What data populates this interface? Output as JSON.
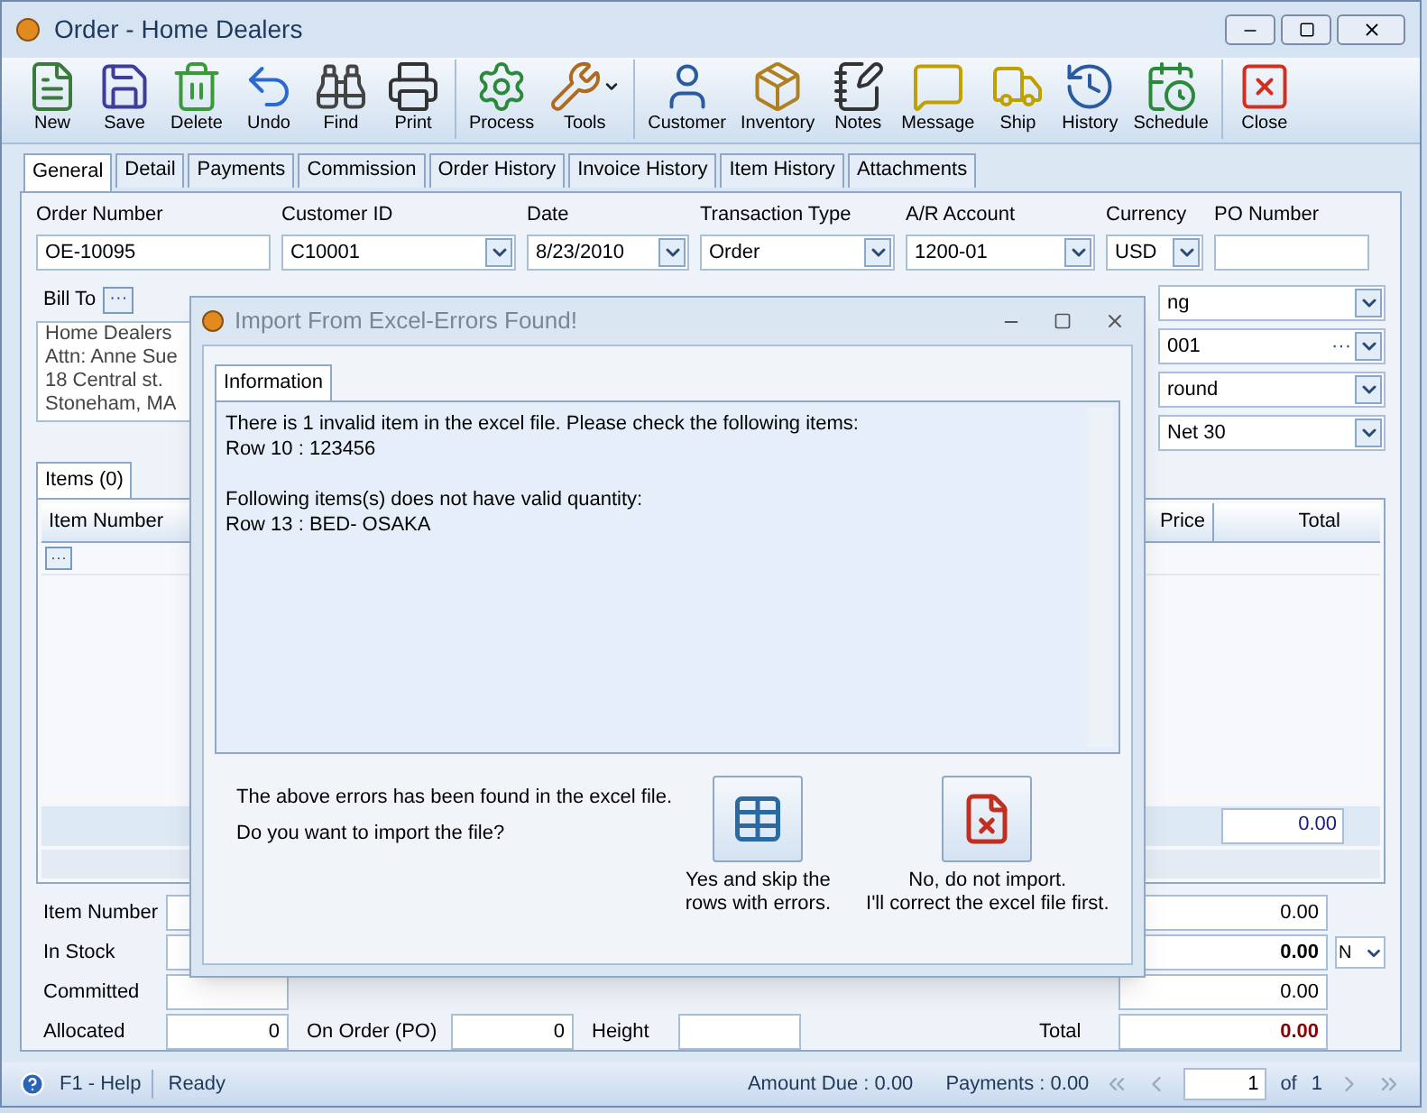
{
  "window": {
    "title": "Order - Home Dealers"
  },
  "toolbar": [
    {
      "label": "New"
    },
    {
      "label": "Save"
    },
    {
      "label": "Delete"
    },
    {
      "label": "Undo"
    },
    {
      "label": "Find"
    },
    {
      "label": "Print",
      "separator_after": true
    },
    {
      "label": "Process"
    },
    {
      "label": "Tools",
      "dropdown": true,
      "separator_after": true
    },
    {
      "label": "Customer"
    },
    {
      "label": "Inventory"
    },
    {
      "label": "Notes"
    },
    {
      "label": "Message"
    },
    {
      "label": "Ship"
    },
    {
      "label": "History"
    },
    {
      "label": "Schedule",
      "separator_after": true
    },
    {
      "label": "Close"
    }
  ],
  "tabs": [
    {
      "label": "General",
      "selected": true
    },
    {
      "label": "Detail",
      "selected": false
    },
    {
      "label": "Payments",
      "selected": false
    },
    {
      "label": "Commission",
      "selected": false
    },
    {
      "label": "Order History",
      "selected": false
    },
    {
      "label": "Invoice History",
      "selected": false
    },
    {
      "label": "Item History",
      "selected": false
    },
    {
      "label": "Attachments",
      "selected": false
    }
  ],
  "header_fields": [
    {
      "label": "Order Number",
      "value": "OE-10095",
      "kind": "text"
    },
    {
      "label": "Customer ID",
      "value": "C10001",
      "kind": "dropdown"
    },
    {
      "label": "Date",
      "value": "8/23/2010",
      "kind": "dropdown"
    },
    {
      "label": "Transaction Type",
      "value": "Order",
      "kind": "dropdown"
    },
    {
      "label": "A/R Account",
      "value": "1200-01",
      "kind": "dropdown"
    },
    {
      "label": "Currency",
      "value": "USD",
      "kind": "dropdown"
    },
    {
      "label": "PO Number",
      "kind": "text"
    }
  ],
  "bill_to": {
    "label": "Bill To",
    "button": "···",
    "lines": [
      "Home Dealers",
      "Attn: Anne Sue",
      "18 Central st.",
      "Stoneham, MA"
    ]
  },
  "right_fields": [
    {
      "value": "ng",
      "kind": "dropdown"
    },
    {
      "value": "001",
      "kind": "lookup",
      "button": "···"
    },
    {
      "value": "round",
      "kind": "dropdown"
    },
    {
      "value": "Net 30",
      "kind": "dropdown"
    }
  ],
  "items": {
    "tab": "Items (0)",
    "columns": [
      "Item Number",
      "Price",
      "Total"
    ],
    "row_button": "···",
    "footer_total": "0.00"
  },
  "bottom": {
    "left": [
      {
        "label": "Item Number"
      },
      {
        "label": "In Stock"
      },
      {
        "label": "Committed"
      },
      {
        "label": "Allocated",
        "value": "0"
      }
    ],
    "middle": {
      "label": "On Order (PO)",
      "value": "0"
    },
    "third": {
      "label": "Height"
    },
    "right": [
      {
        "value": "0.00",
        "kind": "plain"
      },
      {
        "value": "0.00",
        "kind": "bold",
        "dropdown": "N"
      },
      {
        "value": "0.00",
        "kind": "plain"
      },
      {
        "label": "Total",
        "value": "0.00",
        "kind": "total"
      }
    ]
  },
  "status_bar": {
    "help": "F1 - Help",
    "status": "Ready",
    "amount_due": "Amount Due : 0.00",
    "payments": "Payments : 0.00",
    "page": "1",
    "of": "of",
    "total_pages": "1"
  },
  "dialog": {
    "title": "Import From Excel-Errors Found!",
    "tab": {
      "label": "Information",
      "selected": true
    },
    "message_blocks": [
      [
        "There is 1 invalid item in the excel file. Please check the following items:",
        "Row 10 : 123456"
      ],
      [
        "Following items(s) does not have valid quantity:",
        "Row 13 : BED- OSAKA"
      ]
    ],
    "prompt": [
      "The above errors has been found in the excel file.",
      "Do you want to import the file?"
    ],
    "buttons": [
      {
        "kind": "skip",
        "label": "Yes and skip the\nrows with errors."
      },
      {
        "kind": "cancel",
        "label": "No, do not import.\nI'll correct the excel file first."
      }
    ]
  }
}
